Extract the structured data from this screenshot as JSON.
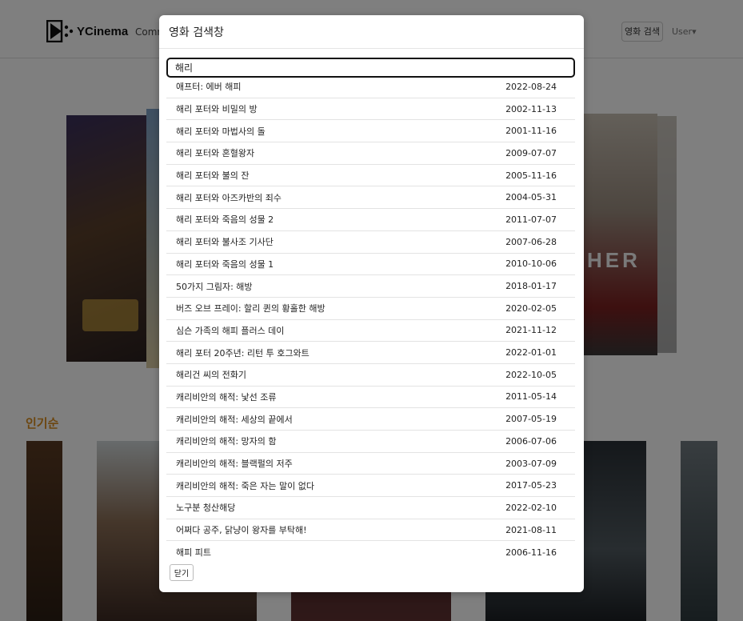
{
  "app": {
    "logo_text": "YCinema",
    "nav_link": "Comm",
    "search_button": "영화 검색",
    "user_menu": "User▾"
  },
  "home": {
    "section_title": "인기순",
    "carousel_text": "HER"
  },
  "modal": {
    "title": "영화 검색창",
    "search_value": "해리",
    "close_label": "닫기",
    "results": [
      {
        "title": "애프터: 에버 해피",
        "date": "2022-08-24"
      },
      {
        "title": "해리 포터와 비밀의 방",
        "date": "2002-11-13"
      },
      {
        "title": "해리 포터와 마법사의 돌",
        "date": "2001-11-16"
      },
      {
        "title": "해리 포터와 혼혈왕자",
        "date": "2009-07-07"
      },
      {
        "title": "해리 포터와 불의 잔",
        "date": "2005-11-16"
      },
      {
        "title": "해리 포터와 아즈카반의 죄수",
        "date": "2004-05-31"
      },
      {
        "title": "해리 포터와 죽음의 성물 2",
        "date": "2011-07-07"
      },
      {
        "title": "해리 포터와 불사조 기사단",
        "date": "2007-06-28"
      },
      {
        "title": "해리 포터와 죽음의 성물 1",
        "date": "2010-10-06"
      },
      {
        "title": "50가지 그림자: 해방",
        "date": "2018-01-17"
      },
      {
        "title": "버즈 오브 프레이: 할리 퀸의 황홀한 해방",
        "date": "2020-02-05"
      },
      {
        "title": "심슨 가족의 해피 플러스 데이",
        "date": "2021-11-12"
      },
      {
        "title": "해리 포터 20주년: 리턴 투 호그와트",
        "date": "2022-01-01"
      },
      {
        "title": "해리건 씨의 전화기",
        "date": "2022-10-05"
      },
      {
        "title": "캐리비안의 해적: 낯선 조류",
        "date": "2011-05-14"
      },
      {
        "title": "캐리비안의 해적: 세상의 끝에서",
        "date": "2007-05-19"
      },
      {
        "title": "캐리비안의 해적: 망자의 함",
        "date": "2006-07-06"
      },
      {
        "title": "캐리비안의 해적: 블랙펄의 저주",
        "date": "2003-07-09"
      },
      {
        "title": "캐리비안의 해적: 죽은 자는 말이 없다",
        "date": "2017-05-23"
      },
      {
        "title": "노구분 청산해당",
        "date": "2022-02-10"
      },
      {
        "title": "어쩌다 공주, 닭냥이 왕자를 부탁해!",
        "date": "2021-08-11"
      },
      {
        "title": "해피 피트",
        "date": "2006-11-16"
      }
    ]
  }
}
